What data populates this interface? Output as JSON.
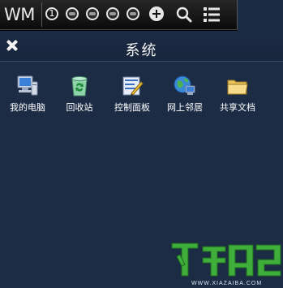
{
  "wm_bar": {
    "logo_text": "WM",
    "workspace_number": "1"
  },
  "window": {
    "title": "系统",
    "icons": [
      {
        "label": "我的电脑",
        "icon": "computer-icon"
      },
      {
        "label": "回收站",
        "icon": "recycle-bin-icon"
      },
      {
        "label": "控制面板",
        "icon": "control-panel-icon"
      },
      {
        "label": "网上邻居",
        "icon": "network-icon"
      },
      {
        "label": "共享文档",
        "icon": "folder-icon"
      }
    ]
  },
  "watermark": {
    "url": "WWW.XIAZAIBA.COM"
  },
  "colors": {
    "panel_bg": "#1c2c45",
    "topbar_bg": "#111111",
    "watermark_green": "#3fae3a"
  }
}
